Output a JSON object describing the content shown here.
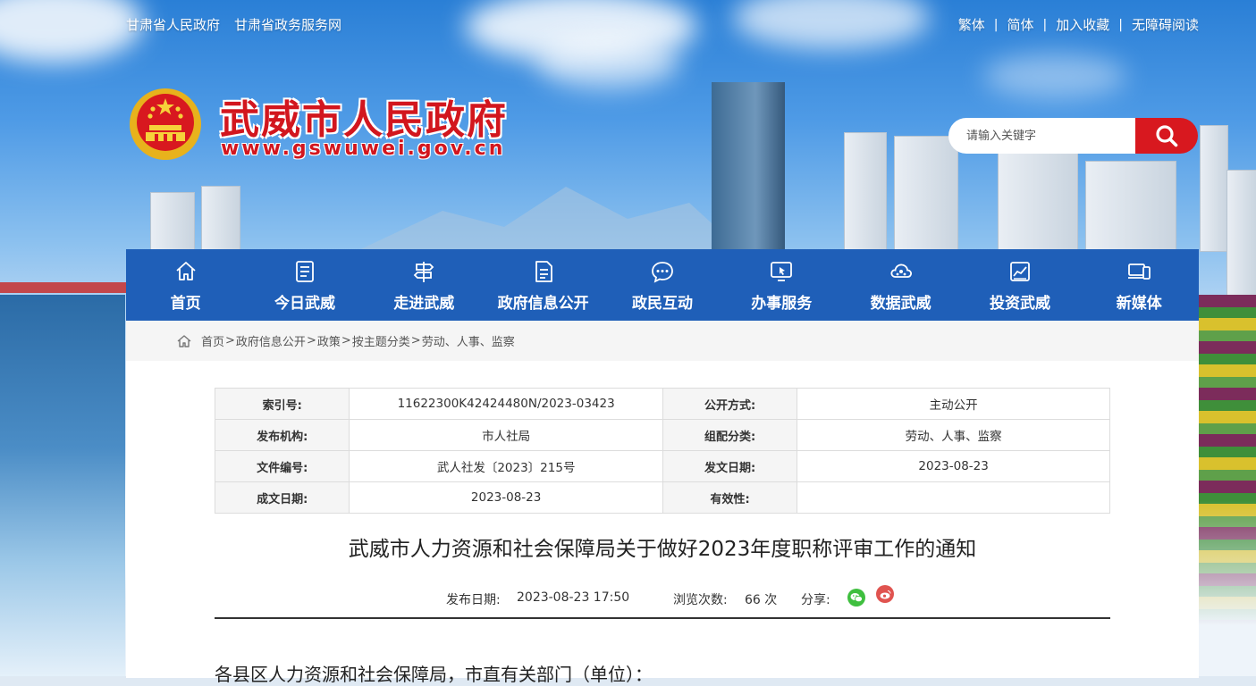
{
  "header": {
    "top_left_links": [
      "甘肃省人民政府",
      "甘肃省政务服务网"
    ],
    "top_right_links": [
      "繁体",
      "简体",
      "加入收藏",
      "无障碍阅读"
    ],
    "top_right_separator": "|",
    "site_title": "武威市人民政府",
    "site_url": "www.gswuwei.gov.cn",
    "search_placeholder": "请输入关键字",
    "search_icon": "search-icon",
    "accent_color": "#d8181f",
    "nav_color": "#1f5fb8"
  },
  "nav": [
    {
      "label": "首页",
      "icon": "home-icon"
    },
    {
      "label": "今日武威",
      "icon": "newspaper-icon"
    },
    {
      "label": "走进武威",
      "icon": "signpost-icon"
    },
    {
      "label": "政府信息公开",
      "icon": "document-icon"
    },
    {
      "label": "政民互动",
      "icon": "chat-icon"
    },
    {
      "label": "办事服务",
      "icon": "monitor-click-icon"
    },
    {
      "label": "数据武威",
      "icon": "data-network-icon"
    },
    {
      "label": "投资武威",
      "icon": "chart-icon"
    },
    {
      "label": "新媒体",
      "icon": "devices-icon"
    }
  ],
  "breadcrumb": {
    "icon": "home-icon",
    "items": [
      "首页",
      "政府信息公开",
      "政策",
      "按主题分类",
      "劳动、人事、监察"
    ],
    "separator": ">"
  },
  "meta": {
    "rows": [
      {
        "k1": "索引号:",
        "v1": "11622300K42424480N/2023-03423",
        "k2": "公开方式:",
        "v2": "主动公开"
      },
      {
        "k1": "发布机构:",
        "v1": "市人社局",
        "k2": "组配分类:",
        "v2": "劳动、人事、监察"
      },
      {
        "k1": "文件编号:",
        "v1": "武人社发〔2023〕215号",
        "k2": "发文日期:",
        "v2": "2023-08-23"
      },
      {
        "k1": "成文日期:",
        "v1": "2023-08-23",
        "k2": "有效性:",
        "v2": ""
      }
    ]
  },
  "article": {
    "title": "武威市人力资源和社会保障局关于做好2023年度职称评审工作的通知",
    "publish_label": "发布日期:",
    "publish_value": "2023-08-23 17:50",
    "views_label": "浏览次数:",
    "views_value": "66 次",
    "share_label": "分享:",
    "share_icons": [
      "wechat-icon",
      "weibo-icon"
    ],
    "body_first_line": "各县区人力资源和社会保障局，市直有关部门（单位）："
  }
}
